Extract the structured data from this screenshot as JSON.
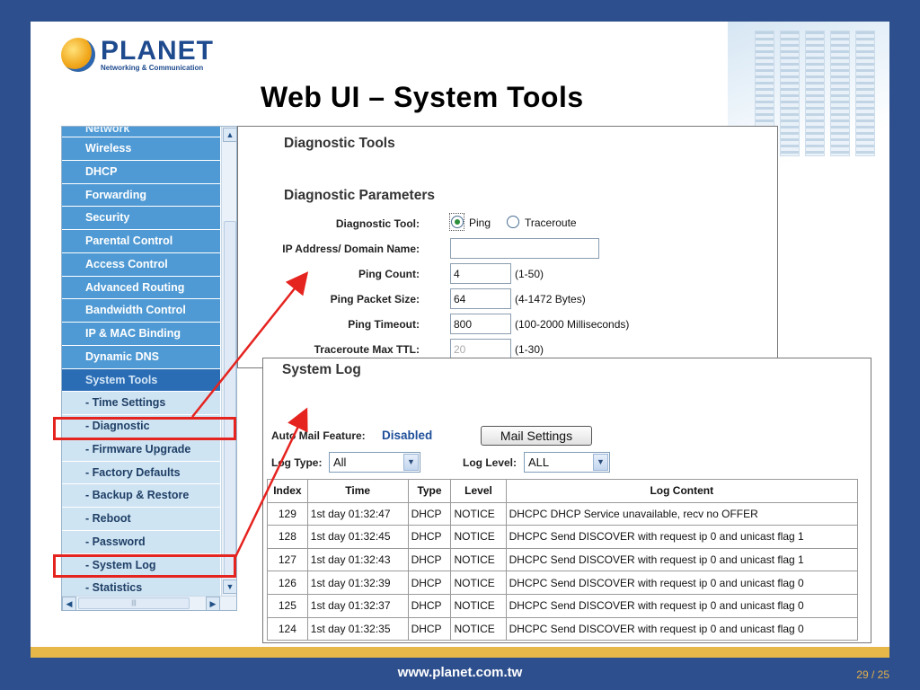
{
  "logo": {
    "brand": "PLANET",
    "tagline": "Networking & Communication"
  },
  "slide": {
    "title": "Web UI – System Tools",
    "url": "www.planet.com.tw",
    "page": "29 / 25"
  },
  "nav": {
    "items": [
      {
        "label": "Network",
        "type": "main"
      },
      {
        "label": "Wireless",
        "type": "main"
      },
      {
        "label": "DHCP",
        "type": "main"
      },
      {
        "label": "Forwarding",
        "type": "main"
      },
      {
        "label": "Security",
        "type": "main"
      },
      {
        "label": "Parental Control",
        "type": "main"
      },
      {
        "label": "Access Control",
        "type": "main"
      },
      {
        "label": "Advanced Routing",
        "type": "main"
      },
      {
        "label": "Bandwidth Control",
        "type": "main"
      },
      {
        "label": "IP & MAC Binding",
        "type": "main"
      },
      {
        "label": "Dynamic DNS",
        "type": "main"
      },
      {
        "label": "System Tools",
        "type": "active"
      },
      {
        "label": "- Time Settings",
        "type": "sub"
      },
      {
        "label": "- Diagnostic",
        "type": "sub"
      },
      {
        "label": "- Firmware Upgrade",
        "type": "sub"
      },
      {
        "label": "- Factory Defaults",
        "type": "sub"
      },
      {
        "label": "- Backup & Restore",
        "type": "sub"
      },
      {
        "label": "- Reboot",
        "type": "sub"
      },
      {
        "label": "- Password",
        "type": "sub"
      },
      {
        "label": "- System Log",
        "type": "sub"
      },
      {
        "label": "- Statistics",
        "type": "sub"
      }
    ]
  },
  "diagnostic": {
    "title": "Diagnostic Tools",
    "params_title": "Diagnostic Parameters",
    "tool_label": "Diagnostic Tool:",
    "tool_ping": "Ping",
    "tool_traceroute": "Traceroute",
    "ip_label": "IP Address/ Domain Name:",
    "ip_value": "",
    "ping_count_label": "Ping Count:",
    "ping_count_value": "4",
    "ping_count_hint": "(1-50)",
    "packet_size_label": "Ping Packet Size:",
    "packet_size_value": "64",
    "packet_size_hint": "(4-1472 Bytes)",
    "timeout_label": "Ping Timeout:",
    "timeout_value": "800",
    "timeout_hint": "(100-2000 Milliseconds)",
    "ttl_label": "Traceroute Max TTL:",
    "ttl_value": "20",
    "ttl_hint": "(1-30)"
  },
  "syslog": {
    "title": "System Log",
    "mail_label": "Auto Mail Feature:",
    "mail_value": "Disabled",
    "mail_button": "Mail Settings",
    "log_type_label": "Log Type:",
    "log_type_value": "All",
    "log_level_label": "Log Level:",
    "log_level_value": "ALL",
    "columns": [
      "Index",
      "Time",
      "Type",
      "Level",
      "Log Content"
    ],
    "rows": [
      [
        "129",
        "1st day 01:32:47",
        "DHCP",
        "NOTICE",
        "DHCPC DHCP Service unavailable, recv no OFFER"
      ],
      [
        "128",
        "1st day 01:32:45",
        "DHCP",
        "NOTICE",
        "DHCPC Send DISCOVER with request ip 0 and unicast flag 1"
      ],
      [
        "127",
        "1st day 01:32:43",
        "DHCP",
        "NOTICE",
        "DHCPC Send DISCOVER with request ip 0 and unicast flag 1"
      ],
      [
        "126",
        "1st day 01:32:39",
        "DHCP",
        "NOTICE",
        "DHCPC Send DISCOVER with request ip 0 and unicast flag 0"
      ],
      [
        "125",
        "1st day 01:32:37",
        "DHCP",
        "NOTICE",
        "DHCPC Send DISCOVER with request ip 0 and unicast flag 0"
      ],
      [
        "124",
        "1st day 01:32:35",
        "DHCP",
        "NOTICE",
        "DHCPC Send DISCOVER with request ip 0 and unicast flag 0"
      ]
    ]
  },
  "colors": {
    "nav_main": "#4f9ad4",
    "nav_active": "#2a6db5",
    "nav_sub": "#cfe4f3",
    "highlight": "#e5231f",
    "background": "#2e4f8d",
    "accent_bar": "#e6b84a"
  }
}
